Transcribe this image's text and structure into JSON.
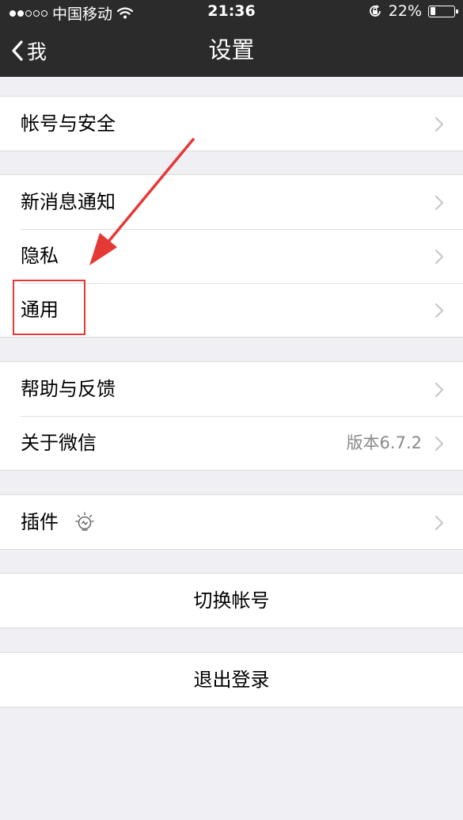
{
  "status_bar": {
    "carrier": "中国移动",
    "time": "21:36",
    "battery_percent": "22%",
    "battery_level": 0.22,
    "signal_dots_filled": 2,
    "signal_dots_total": 5
  },
  "nav": {
    "back_label": "我",
    "title": "设置"
  },
  "groups": [
    {
      "items": [
        {
          "label": "帐号与安全"
        }
      ]
    },
    {
      "items": [
        {
          "label": "新消息通知"
        },
        {
          "label": "隐私"
        },
        {
          "label": "通用"
        }
      ]
    },
    {
      "items": [
        {
          "label": "帮助与反馈"
        },
        {
          "label": "关于微信",
          "detail": "版本6.7.2"
        }
      ]
    },
    {
      "items": [
        {
          "label": "插件",
          "icon": "lightbulb-icon"
        }
      ]
    }
  ],
  "actions": {
    "switch_account": "切换帐号",
    "logout": "退出登录"
  },
  "annotation": {
    "highlighted_item": "通用",
    "color": "#e53935"
  }
}
